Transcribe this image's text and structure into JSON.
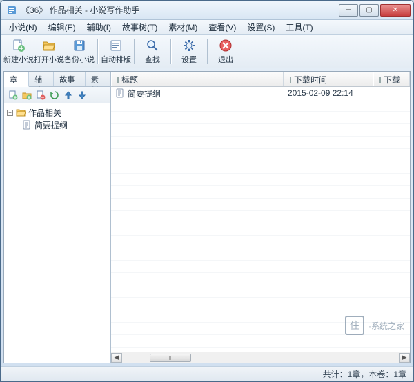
{
  "window": {
    "title": "《36》 作品相关 - 小说写作助手"
  },
  "menu": {
    "novel": "小说(N)",
    "edit": "编辑(E)",
    "assist": "辅助(I)",
    "storytree": "故事树(T)",
    "material": "素材(M)",
    "view": "查看(V)",
    "setting": "设置(S)",
    "tool": "工具(T)"
  },
  "toolbar": {
    "new_novel": "新建小说",
    "open_novel": "打开小说",
    "backup_novel": "备份小说",
    "auto_layout": "自动排版",
    "find": "查找",
    "settings": "设置",
    "exit": "退出"
  },
  "tabs": {
    "chapter": "章节",
    "assist": "辅助",
    "storytree": "故事树",
    "material": "素材"
  },
  "tree": {
    "root": "作品相关",
    "child": "简要提纲"
  },
  "columns": {
    "title": "标题",
    "dl_time": "下载时间",
    "dl_addr": "下载地址"
  },
  "rows": [
    {
      "title": "简要提纲",
      "time": "2015-02-09 22:14",
      "addr": ""
    }
  ],
  "status": {
    "text": "共计：1章，本卷：1章"
  },
  "watermark": {
    "text": "·系统之家",
    "logo": "住"
  },
  "colors": {
    "accent": "#3a6aa8"
  }
}
